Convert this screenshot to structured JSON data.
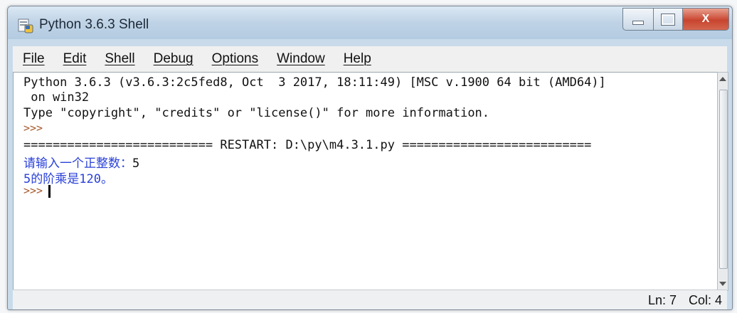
{
  "window": {
    "title": "Python 3.6.3 Shell",
    "close_glyph": "X"
  },
  "menu": [
    "File",
    "Edit",
    "Shell",
    "Debug",
    "Options",
    "Window",
    "Help"
  ],
  "shell": {
    "banner_line1": "Python 3.6.3 (v3.6.3:2c5fed8, Oct  3 2017, 18:11:49) [MSC v.1900 64 bit (AMD64)]",
    "banner_line2": " on win32",
    "banner_line3": "Type \"copyright\", \"credits\" or \"license()\" for more information.",
    "prompt": ">>>",
    "restart_line": "========================== RESTART: D:\\py\\m4.3.1.py ==========================",
    "input_prompt": "请输入一个正整数：",
    "input_value": "5",
    "output_line": "5的阶乘是120。"
  },
  "status": {
    "line": "Ln: 7",
    "col": "Col: 4"
  },
  "icons": {
    "app": "python-idle-icon",
    "minimize": "minimize-icon",
    "maximize": "maximize-icon",
    "close": "close-icon"
  },
  "colors": {
    "shell_output": "#2a41d9",
    "prompt": "#a55a2b",
    "close_button": "#c8452f"
  }
}
